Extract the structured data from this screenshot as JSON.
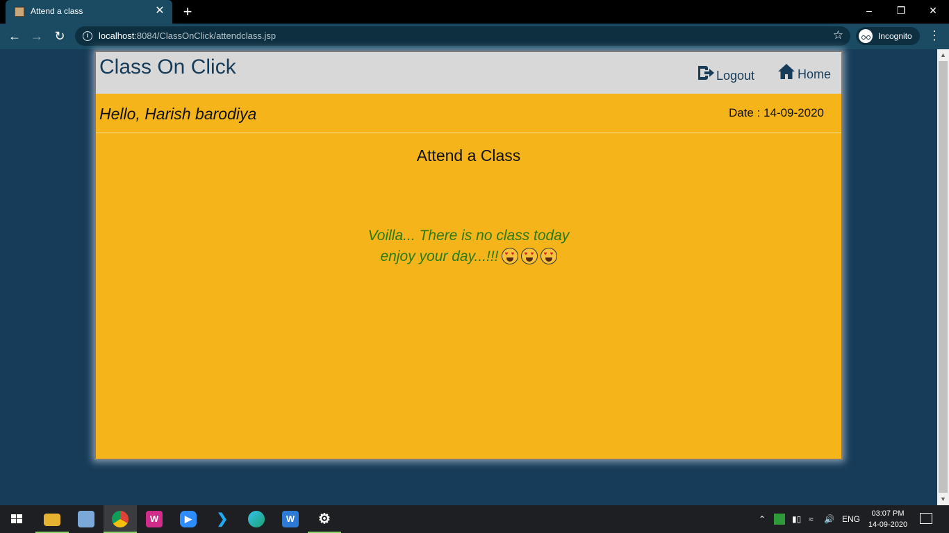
{
  "browser": {
    "tab_title": "Attend a class",
    "tab_close": "✕",
    "new_tab": "+",
    "url_host": "localhost",
    "url_path": ":8084/ClassOnClick/attendclass.jsp",
    "profile_label": "Incognito"
  },
  "app": {
    "brand": "Class On Click",
    "nav_logout": "Logout",
    "nav_home": "Home",
    "greeting": "Hello, Harish barodiya",
    "date_text": "Date : 14-09-2020",
    "page_title": "Attend a Class",
    "message_line1": "Voilla... There is no class today",
    "message_line2": "enjoy your day...!!!"
  },
  "taskbar": {
    "language": "ENG",
    "time": "03:07 PM",
    "date": "14-09-2020"
  },
  "colors": {
    "page_background": "#173c59",
    "card_background": "#f4b41a",
    "header_background": "#d8d8d8",
    "brand_color": "#173c59",
    "message_color": "#2a7a17"
  },
  "icons": [
    "info-icon",
    "star-icon",
    "incognito-icon",
    "logout-icon",
    "home-icon",
    "heart-eyes-emoji",
    "windows-start-icon",
    "settings-icon"
  ]
}
